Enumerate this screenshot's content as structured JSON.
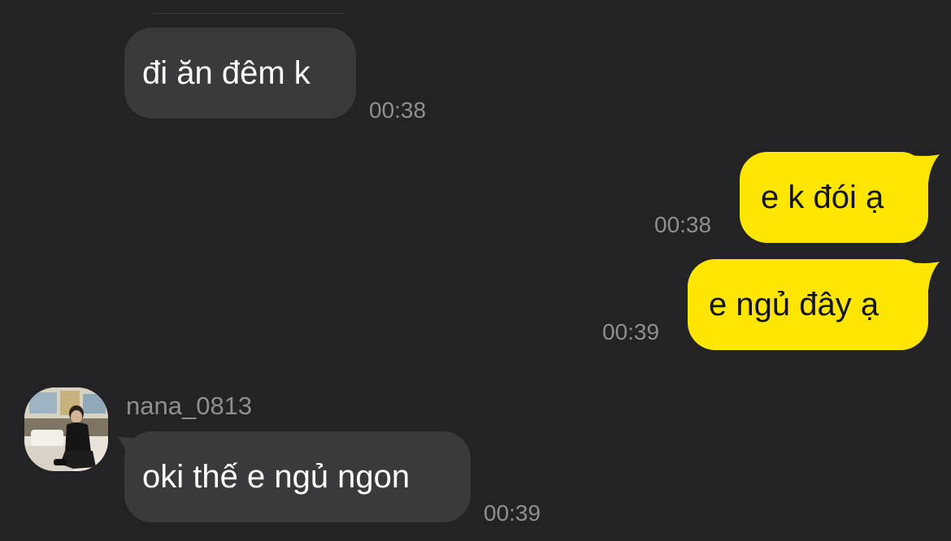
{
  "chat": {
    "accent_color": "#ffe600",
    "incoming_bubble_color": "#3a3a3c",
    "background_color": "#232325",
    "messages": [
      {
        "direction": "incoming",
        "text": "đi ăn đêm k",
        "time": "00:38"
      },
      {
        "direction": "outgoing",
        "text": "e k đói ạ",
        "time": "00:38"
      },
      {
        "direction": "outgoing",
        "text": "e ngủ đây ạ",
        "time": "00:39"
      },
      {
        "direction": "incoming",
        "sender": "nana_0813",
        "avatar": "profile-photo",
        "text": "oki thế e ngủ ngon",
        "time": "00:39"
      }
    ]
  }
}
